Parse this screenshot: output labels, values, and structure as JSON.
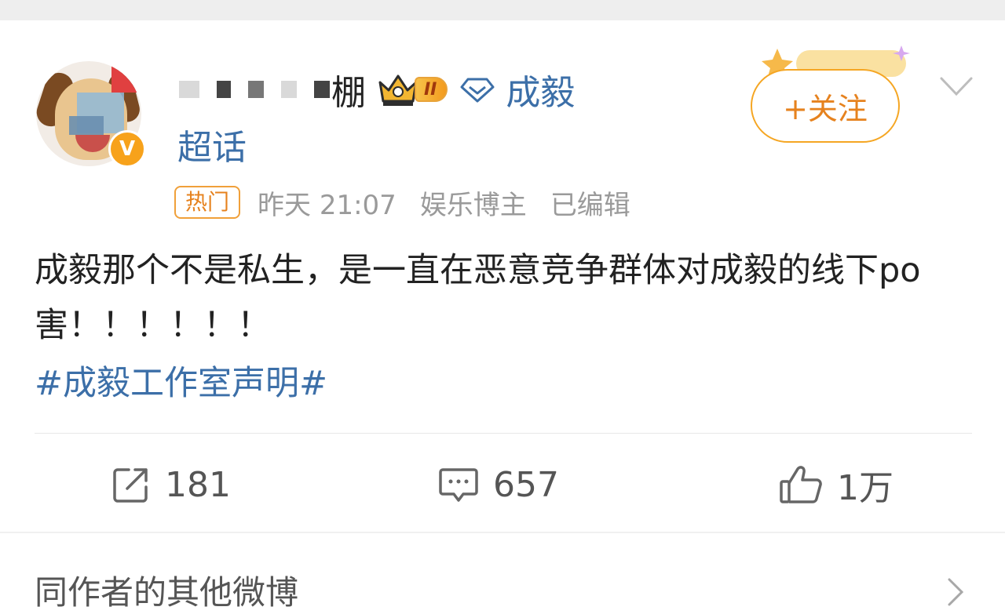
{
  "post": {
    "author": {
      "name_visible": "棚",
      "level_badge": "II",
      "super_topic": "成毅",
      "super_topic_suffix": "超话",
      "verified_mark": "V"
    },
    "follow_button": "+关注",
    "meta": {
      "hot_tag": "热门",
      "time": "昨天 21:07",
      "category": "娱乐博主",
      "edited": "已编辑"
    },
    "text": "成毅那个不是私生，是一直在恶意竞争群体对成毅的线下po害！！！！！！",
    "hashtag": "#成毅工作室声明#",
    "actions": {
      "repost_count": "181",
      "comment_count": "657",
      "like_count": "1万"
    }
  },
  "more_section": {
    "label": "同作者的其他微博"
  },
  "colors": {
    "link_blue": "#3c6fa8",
    "accent_orange": "#f5a623",
    "meta_gray": "#9a9a9a"
  },
  "icons": [
    "crown-icon",
    "super-topic-diamond-icon",
    "chevron-down-icon",
    "repost-icon",
    "comment-icon",
    "like-icon",
    "chevron-right-icon"
  ]
}
